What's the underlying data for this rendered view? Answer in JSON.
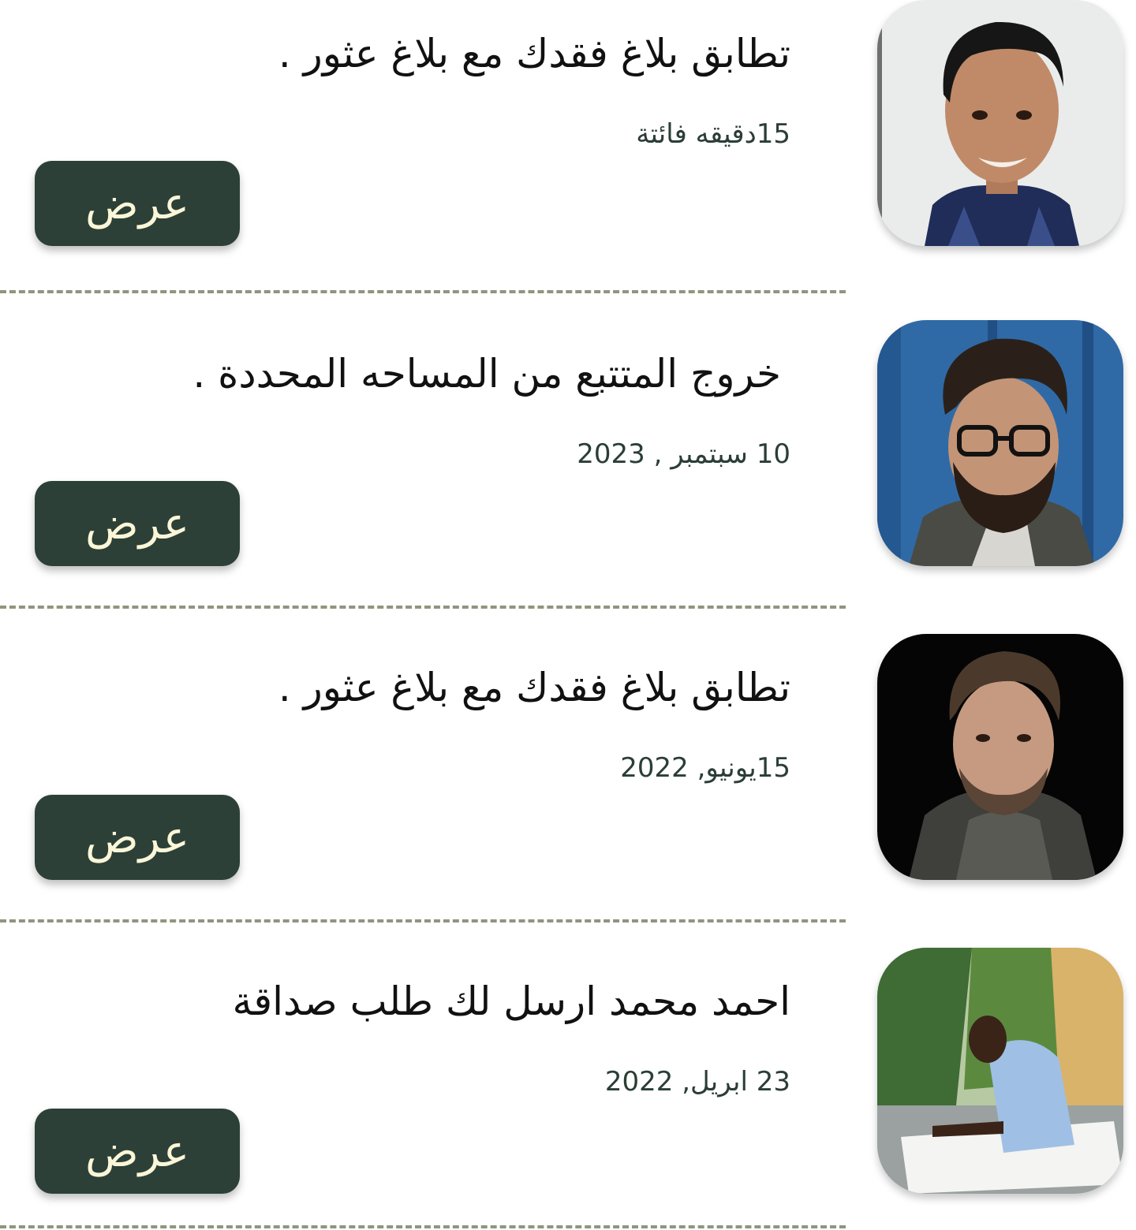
{
  "colors": {
    "button_bg": "#2c4037",
    "button_text": "#fbf6d8",
    "divider": "#8f957f",
    "time_text": "#2b3e36"
  },
  "notifications": [
    {
      "title": "تطابق بلاغ فقدك مع بلاغ عثور .",
      "time": "15دقيقه فائتة",
      "action_label": "عرض",
      "avatar": "boy-portrait-photo"
    },
    {
      "title": "خروج المتتبع من المساحه المحددة .",
      "time": "10 سبتمبر , 2023",
      "action_label": "عرض",
      "avatar": "bearded-man-glasses-photo"
    },
    {
      "title": "تطابق بلاغ فقدك مع بلاغ عثور .",
      "time": "15يونيو, 2022",
      "action_label": "عرض",
      "avatar": "man-dark-background-photo"
    },
    {
      "title": "احمد محمد ارسل لك طلب صداقة",
      "time": "23 ابريل, 2022",
      "action_label": "عرض",
      "avatar": "man-outdoor-photo"
    }
  ]
}
